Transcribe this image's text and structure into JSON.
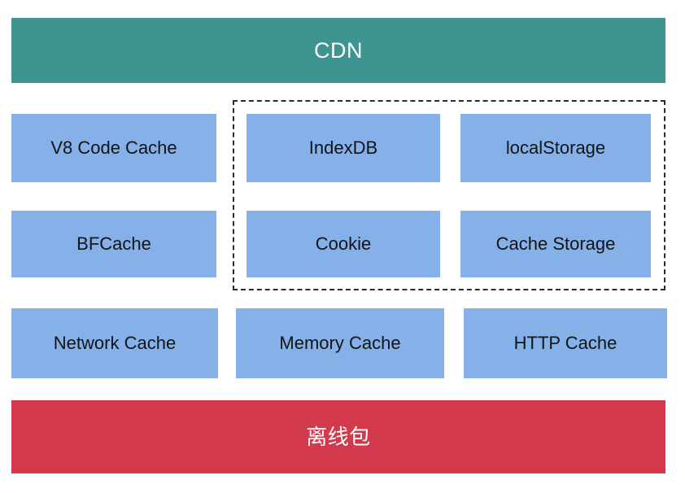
{
  "diagram": {
    "title_top": "CDN",
    "title_bottom": "离线包",
    "colors": {
      "top_band": "#3d9490",
      "bottom_band": "#d3394c",
      "cell": "#86b1e8",
      "dashed_border": "#2b2b2b",
      "page_background": "#ffffff",
      "band_text": "#ffffff",
      "cell_text": "#111418"
    },
    "top_band": {
      "label": "CDN"
    },
    "bottom_band": {
      "label": "离线包"
    },
    "dashed_group": {
      "label": "",
      "member_cells": [
        "IndexDB",
        "localStorage",
        "Cookie",
        "Cache Storage"
      ]
    },
    "rows": [
      {
        "cells": [
          {
            "label": "V8 Code Cache"
          },
          {
            "label": "IndexDB"
          },
          {
            "label": "localStorage"
          }
        ]
      },
      {
        "cells": [
          {
            "label": "BFCache"
          },
          {
            "label": "Cookie"
          },
          {
            "label": "Cache Storage"
          }
        ]
      },
      {
        "cells": [
          {
            "label": "Network Cache"
          },
          {
            "label": "Memory Cache"
          },
          {
            "label": "HTTP Cache"
          }
        ]
      }
    ]
  }
}
